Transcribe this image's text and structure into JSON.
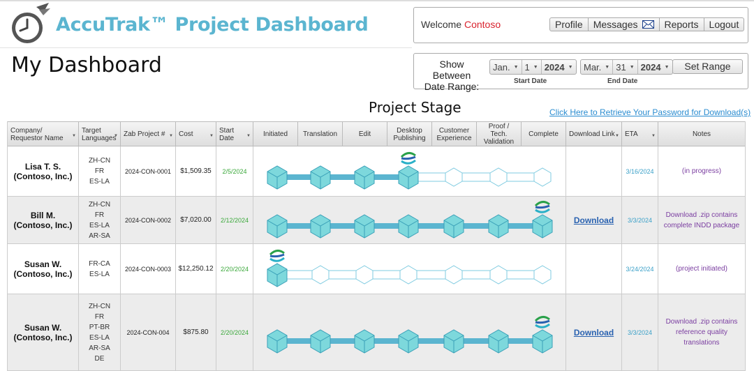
{
  "header": {
    "brand": "AccuTrak™ Project Dashboard",
    "welcome_prefix": "Welcome",
    "welcome_user": "Contoso",
    "nav": [
      "Profile",
      "Messages",
      "Reports",
      "Logout"
    ]
  },
  "page_title": "My Dashboard",
  "range": {
    "label_line1": "Show Between",
    "label_line2": "Date Range:",
    "start": {
      "month": "Jan.",
      "day": "1",
      "year": "2024",
      "caption": "Start Date"
    },
    "end": {
      "month": "Mar.",
      "day": "31",
      "year": "2024",
      "caption": "End Date"
    },
    "set_button": "Set Range"
  },
  "stage_title": "Project Stage",
  "password_link": "Click Here to Retrieve Your Password for Download(s)",
  "columns": {
    "company": "Company/ Requestor Name",
    "languages": "Target Languages",
    "project": "Zab Project #",
    "cost": "Cost",
    "start": "Start Date",
    "stages": [
      "Initiated",
      "Translation",
      "Edit",
      "Desktop Publishing",
      "Customer Experience",
      "Proof / Tech. Validation",
      "Complete"
    ],
    "download": "Download Link",
    "eta": "ETA",
    "notes": "Notes"
  },
  "rows": [
    {
      "name1": "Lisa T. S.",
      "name2": "(Contoso, Inc.)",
      "languages": [
        "ZH-CN",
        "FR",
        "ES-LA"
      ],
      "project": "2024-CON-0001",
      "cost": "$1,509.35",
      "start": "2/5/2024",
      "stage_reached": 4,
      "download": "",
      "eta": "3/16/2024",
      "notes": [
        "(in progress)"
      ]
    },
    {
      "name1": "Bill M.",
      "name2": "(Contoso, Inc.)",
      "languages": [
        "ZH-CN",
        "FR",
        "ES-LA",
        "AR-SA"
      ],
      "project": "2024-CON-0002",
      "cost": "$7,020.00",
      "start": "2/12/2024",
      "stage_reached": 7,
      "download": "Download",
      "eta": "3/3/2024",
      "notes": [
        "Download .zip contains",
        "complete INDD package"
      ]
    },
    {
      "name1": "Susan W.",
      "name2": "(Contoso, Inc.)",
      "languages": [
        "FR-CA",
        "ES-LA"
      ],
      "project": "2024-CON-0003",
      "cost": "$12,250.12",
      "start": "2/20/2024",
      "stage_reached": 1,
      "download": "",
      "eta": "3/24/2024",
      "notes": [
        "(project initiated)"
      ]
    },
    {
      "name1": "Susan W.",
      "name2": "(Contoso, Inc.)",
      "languages": [
        "ZH-CN",
        "FR",
        "PT-BR",
        "ES-LA",
        "AR-SA",
        "DE"
      ],
      "project": "2024-CON-004",
      "cost": "$875.80",
      "start": "2/20/2024",
      "stage_reached": 7,
      "download": "Download",
      "eta": "3/3/2024",
      "notes": [
        "Download .zip contains",
        "reference quality",
        "translations"
      ]
    }
  ],
  "colors": {
    "accent": "#5bb5d0",
    "cube": "#7dd8dc",
    "track": "#5bb5d0",
    "user": "#d9232e"
  }
}
